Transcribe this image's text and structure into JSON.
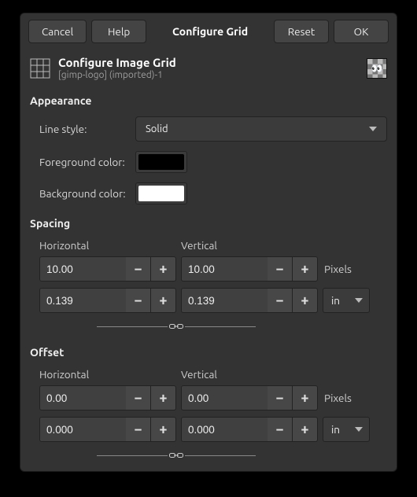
{
  "titlebar": {
    "cancel": "Cancel",
    "help": "Help",
    "title": "Configure Grid",
    "reset": "Reset",
    "ok": "OK"
  },
  "header": {
    "title": "Configure Image Grid",
    "subtitle": "[gimp-logo] (imported)-1"
  },
  "appearance": {
    "section": "Appearance",
    "line_style_label": "Line style:",
    "line_style_value": "Solid",
    "fg_label": "Foreground color:",
    "fg_color": "#000000",
    "bg_label": "Background color:",
    "bg_color": "#ffffff"
  },
  "spacing": {
    "section": "Spacing",
    "horizontal_label": "Horizontal",
    "vertical_label": "Vertical",
    "h_px": "10.00",
    "v_px": "10.00",
    "h_unit": "0.139",
    "v_unit": "0.139",
    "px_label": "Pixels",
    "unit_value": "in"
  },
  "offset": {
    "section": "Offset",
    "horizontal_label": "Horizontal",
    "vertical_label": "Vertical",
    "h_px": "0.00",
    "v_px": "0.00",
    "h_unit": "0.000",
    "v_unit": "0.000",
    "px_label": "Pixels",
    "unit_value": "in"
  }
}
